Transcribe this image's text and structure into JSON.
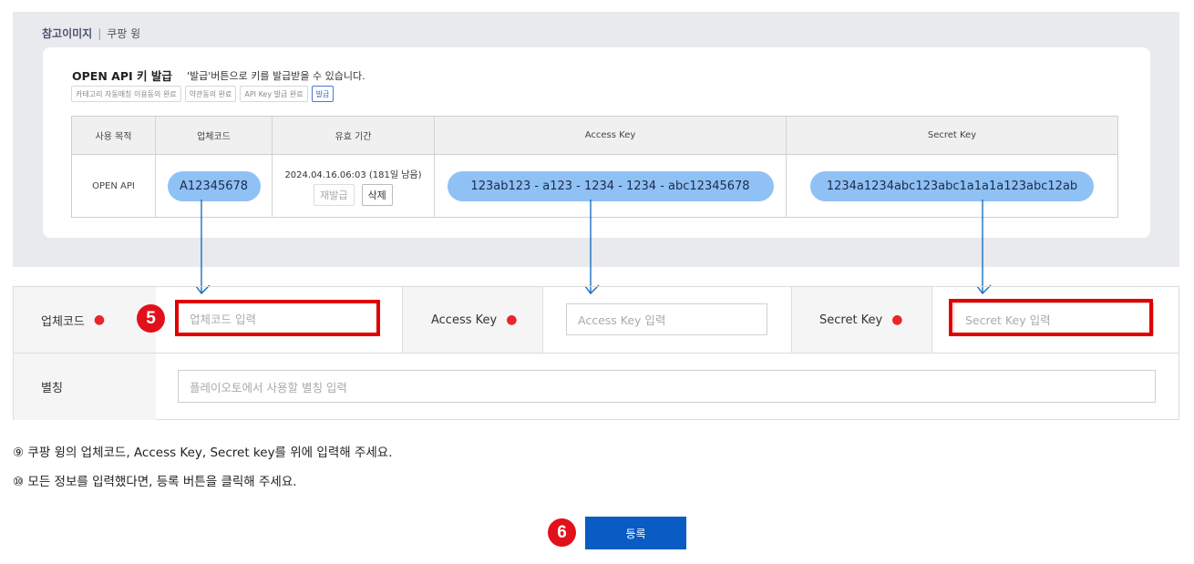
{
  "reference": {
    "title_main": "참고이미지",
    "title_sep": "|",
    "title_sub": "쿠팡 윙",
    "card_heading": "OPEN API 키 발급",
    "card_desc": "'발급'버튼으로 키를 발급받을 수 있습니다.",
    "steps": [
      "카테고리 자동매칭 이용동의 완료",
      "약관동의 완료",
      "API Key 발급 완료",
      "발급"
    ],
    "table": {
      "headers": [
        "사용 목적",
        "업체코드",
        "유효 기간",
        "Access Key",
        "Secret Key"
      ],
      "row": {
        "purpose": "OPEN API",
        "vendor_code": "A12345678",
        "validity": "2024.04.16.06:03 (181일 남음)",
        "reissue_label": "재발급",
        "delete_label": "삭제",
        "access_key": "123ab123 - a123 - 1234 - 1234 - abc12345678",
        "secret_key": "1234a1234abc123abc1a1a1a123abc12ab"
      }
    },
    "colors": {
      "pill": "#8fc1f5",
      "arrow": "#1a6ec0",
      "panel": "#e9eaee"
    }
  },
  "form": {
    "vendor_code_label": "업체코드",
    "vendor_code_placeholder": "업체코드 입력",
    "access_key_label": "Access Key",
    "access_key_placeholder": "Access Key 입력",
    "secret_key_label": "Secret Key",
    "secret_key_placeholder": "Secret Key 입력",
    "alias_label": "별칭",
    "alias_placeholder": "플레이오토에서 사용할 별칭 입력",
    "required_mark": "●"
  },
  "badges": {
    "step5": "5",
    "step6": "6"
  },
  "notes": {
    "note9": "⑨ 쿠팡 윙의 업체코드, Access Key, Secret key를 위에 입력해 주세요.",
    "note10": "⑩ 모든 정보를 입력했다면, 등록 버튼을 클릭해 주세요."
  },
  "submit_label": "등록",
  "accent_colors": {
    "highlight": "#e00000",
    "badge": "#e3101b",
    "button": "#0a5bc4"
  }
}
